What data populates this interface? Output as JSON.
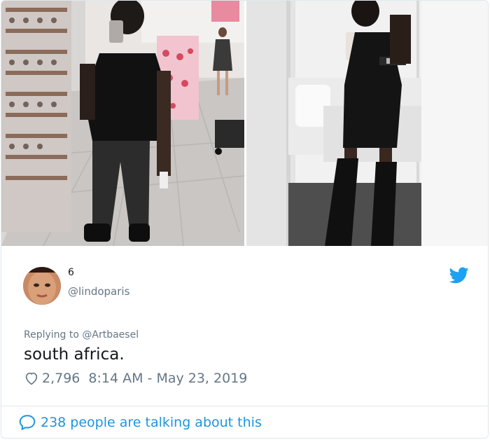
{
  "tweet": {
    "display_name": "6",
    "handle": "@lindoparis",
    "replying_prefix": "Replying to",
    "replying_to": "@Artbaesel",
    "text": "south africa.",
    "likes": "2,796",
    "timestamp": "8:14 AM - May 23, 2019",
    "talking": "238 people are talking about this"
  },
  "icons": {
    "brand": "twitter-bird-icon",
    "like": "heart-outline-icon",
    "conversation": "speech-bubble-icon"
  },
  "colors": {
    "twitter_blue": "#1da1f2",
    "link_blue": "#1b95e0",
    "secondary_text": "#657786",
    "primary_text": "#14171a",
    "border": "#e1e8ed"
  }
}
